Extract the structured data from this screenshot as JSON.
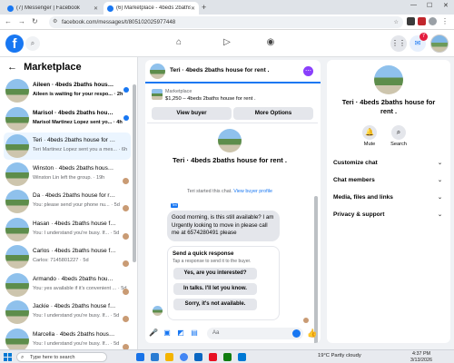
{
  "browser": {
    "tabs": [
      {
        "title": "(7) Messenger | Facebook",
        "active": false
      },
      {
        "title": "(6) Marketplace - 4beds 2baths",
        "active": true
      }
    ],
    "url": "facebook.com/messages/t/805102025977448"
  },
  "fb": {
    "brand": "f",
    "notification_count": "7"
  },
  "sidebar": {
    "title": "Marketplace",
    "conversations": [
      {
        "title": "Aileen · 4beds 2baths house fo...",
        "preview": "Aileen is waiting for your respo... · 2h",
        "unread": true,
        "selected": false,
        "dot": true
      },
      {
        "title": "Marisol · 4beds 2baths house fo...",
        "preview": "Marisol Martinez Lopez sent yo... · 4h",
        "unread": true,
        "selected": false,
        "dot": true
      },
      {
        "title": "Teri · 4beds 2baths house for rent .",
        "preview": "Teri Martinez Lopez sent you a mes... · 6h",
        "unread": false,
        "selected": true,
        "dot": false
      },
      {
        "title": "Winston · 4beds 2baths house fo...",
        "preview": "Winston Lin left the group. · 19h",
        "unread": false,
        "selected": false,
        "dot": false
      },
      {
        "title": "Da · 4beds 2baths house for rent .",
        "preview": "You: please send your phone nu... · 5d",
        "unread": false,
        "selected": false,
        "dot": false
      },
      {
        "title": "Hasan · 4beds 2baths house for ...",
        "preview": "You: I understand you're busy. If... · 5d",
        "unread": false,
        "selected": false,
        "dot": false
      },
      {
        "title": "Carlos · 4beds 2baths house for r...",
        "preview": "Carlos: 7145801227 · 5d",
        "unread": false,
        "selected": false,
        "dot": false
      },
      {
        "title": "Armando · 4beds 2baths house f...",
        "preview": "You: yes available if it's convenient ... · 5d",
        "unread": false,
        "selected": false,
        "dot": false
      },
      {
        "title": "Jackie · 4beds 2baths house for ...",
        "preview": "You: I understand you're busy. If... · 5d",
        "unread": false,
        "selected": false,
        "dot": false
      },
      {
        "title": "Marcella · 4beds 2baths house fo...",
        "preview": "You: I understand you're busy. If... · 5d",
        "unread": false,
        "selected": false,
        "dot": false
      }
    ]
  },
  "chat": {
    "header_name": "Teri · 4beds 2baths house for rent .",
    "listing": {
      "label": "Marketplace",
      "price_title": "$1,250 – 4beds 2baths house for rent .",
      "view_buyer": "View buyer",
      "more_options": "More Options"
    },
    "profile_name": "Teri · 4beds 2baths house for rent .",
    "started_text": "Teri started this chat.",
    "view_profile": "View buyer profile",
    "message": "Good morning, is this still available? I am Urgently looking to move in please call me at 6574280491 please",
    "quick_reply": {
      "title": "Send a quick response",
      "subtitle": "Tap a response to send it to the buyer.",
      "options": [
        "Yes, are you interested?",
        "In talks. I'll let you know.",
        "Sorry, it's not available."
      ]
    },
    "composer_placeholder": "Aa"
  },
  "details": {
    "name": "Teri · 4beds 2baths house for rent .",
    "actions": [
      {
        "label": "Mute",
        "icon": "bell-icon"
      },
      {
        "label": "Search",
        "icon": "search-icon"
      }
    ],
    "sections": [
      "Customize chat",
      "Chat members",
      "Media, files and links",
      "Privacy & support"
    ]
  },
  "taskbar": {
    "search_placeholder": "Type here to search",
    "weather": "19°C  Partly cloudy",
    "time": "4:37 PM",
    "date": "3/13/2026"
  }
}
